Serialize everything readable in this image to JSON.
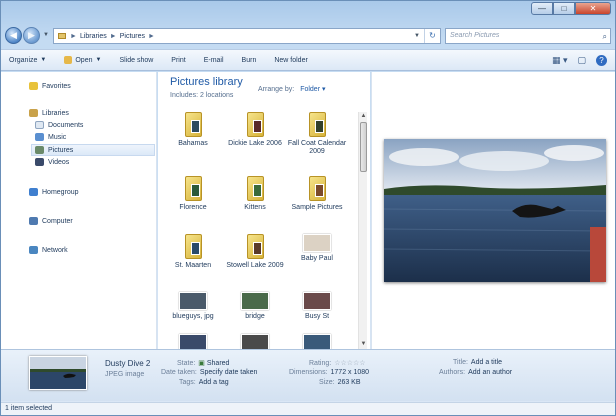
{
  "window": {
    "controls": {
      "minimize": "—",
      "maximize": "□",
      "close": "✕"
    }
  },
  "address": {
    "crumbs": [
      "Libraries",
      "Pictures"
    ],
    "separator": "►",
    "search_placeholder": "Search Pictures"
  },
  "toolbar": {
    "organize": "Organize",
    "open": "Open",
    "slideshow": "Slide show",
    "print": "Print",
    "email": "E-mail",
    "burn": "Burn",
    "new_folder": "New folder"
  },
  "nav": {
    "favorites": "Favorites",
    "libraries": "Libraries",
    "documents": "Documents",
    "music": "Music",
    "pictures": "Pictures",
    "videos": "Videos",
    "homegroup": "Homegroup",
    "computer": "Computer",
    "network": "Network"
  },
  "content": {
    "title": "Pictures library",
    "subtitle": "Includes: 2 locations",
    "arrange_label": "Arrange by:",
    "arrange_value": "Folder ▾",
    "files": [
      {
        "name": "Bahamas",
        "kind": "folder",
        "color": "#2c4a5e"
      },
      {
        "name": "Dickie Lake 2006",
        "kind": "folder",
        "color": "#5a2a2a"
      },
      {
        "name": "Fall Coat Calendar 2009",
        "kind": "folder",
        "color": "#33402a"
      },
      {
        "name": "Florence",
        "kind": "folder",
        "color": "#2a5a3a"
      },
      {
        "name": "Kittens",
        "kind": "folder",
        "color": "#3a6a3a"
      },
      {
        "name": "Sample Pictures",
        "kind": "folder",
        "color": "#7a4a2a"
      },
      {
        "name": "St. Maarten",
        "kind": "folder",
        "color": "#2a4a6a"
      },
      {
        "name": "Stowell Lake 2009",
        "kind": "folder",
        "color": "#5a3a2a"
      },
      {
        "name": "Baby Paul",
        "kind": "photo",
        "color": "#dcd2c4"
      },
      {
        "name": "blueguys, jpg",
        "kind": "photo",
        "color": "#4a5a6a"
      },
      {
        "name": "bridge",
        "kind": "photo",
        "color": "#4a6a4a"
      },
      {
        "name": "Busy St",
        "kind": "photo",
        "color": "#6a4a4a"
      },
      {
        "name": "",
        "kind": "photo",
        "color": "#3a4a6a"
      },
      {
        "name": "",
        "kind": "photo",
        "color": "#4a4a4a"
      },
      {
        "name": "",
        "kind": "photo",
        "color": "#3a5a7a"
      }
    ]
  },
  "details": {
    "filename": "Dusty Dive 2",
    "filetype": "JPEG image",
    "state_label": "State:",
    "state_value": "Shared",
    "datetaken_label": "Date taken:",
    "datetaken_value": "Specify date taken",
    "tags_label": "Tags:",
    "tags_value": "Add a tag",
    "rating_label": "Rating:",
    "rating_value": "☆☆☆☆☆",
    "dimensions_label": "Dimensions:",
    "dimensions_value": "1772 x 1080",
    "size_label": "Size:",
    "size_value": "263 KB",
    "title_label": "Title:",
    "title_value": "Add a title",
    "authors_label": "Authors:",
    "authors_value": "Add an author"
  },
  "status": {
    "text": "1 item selected"
  }
}
